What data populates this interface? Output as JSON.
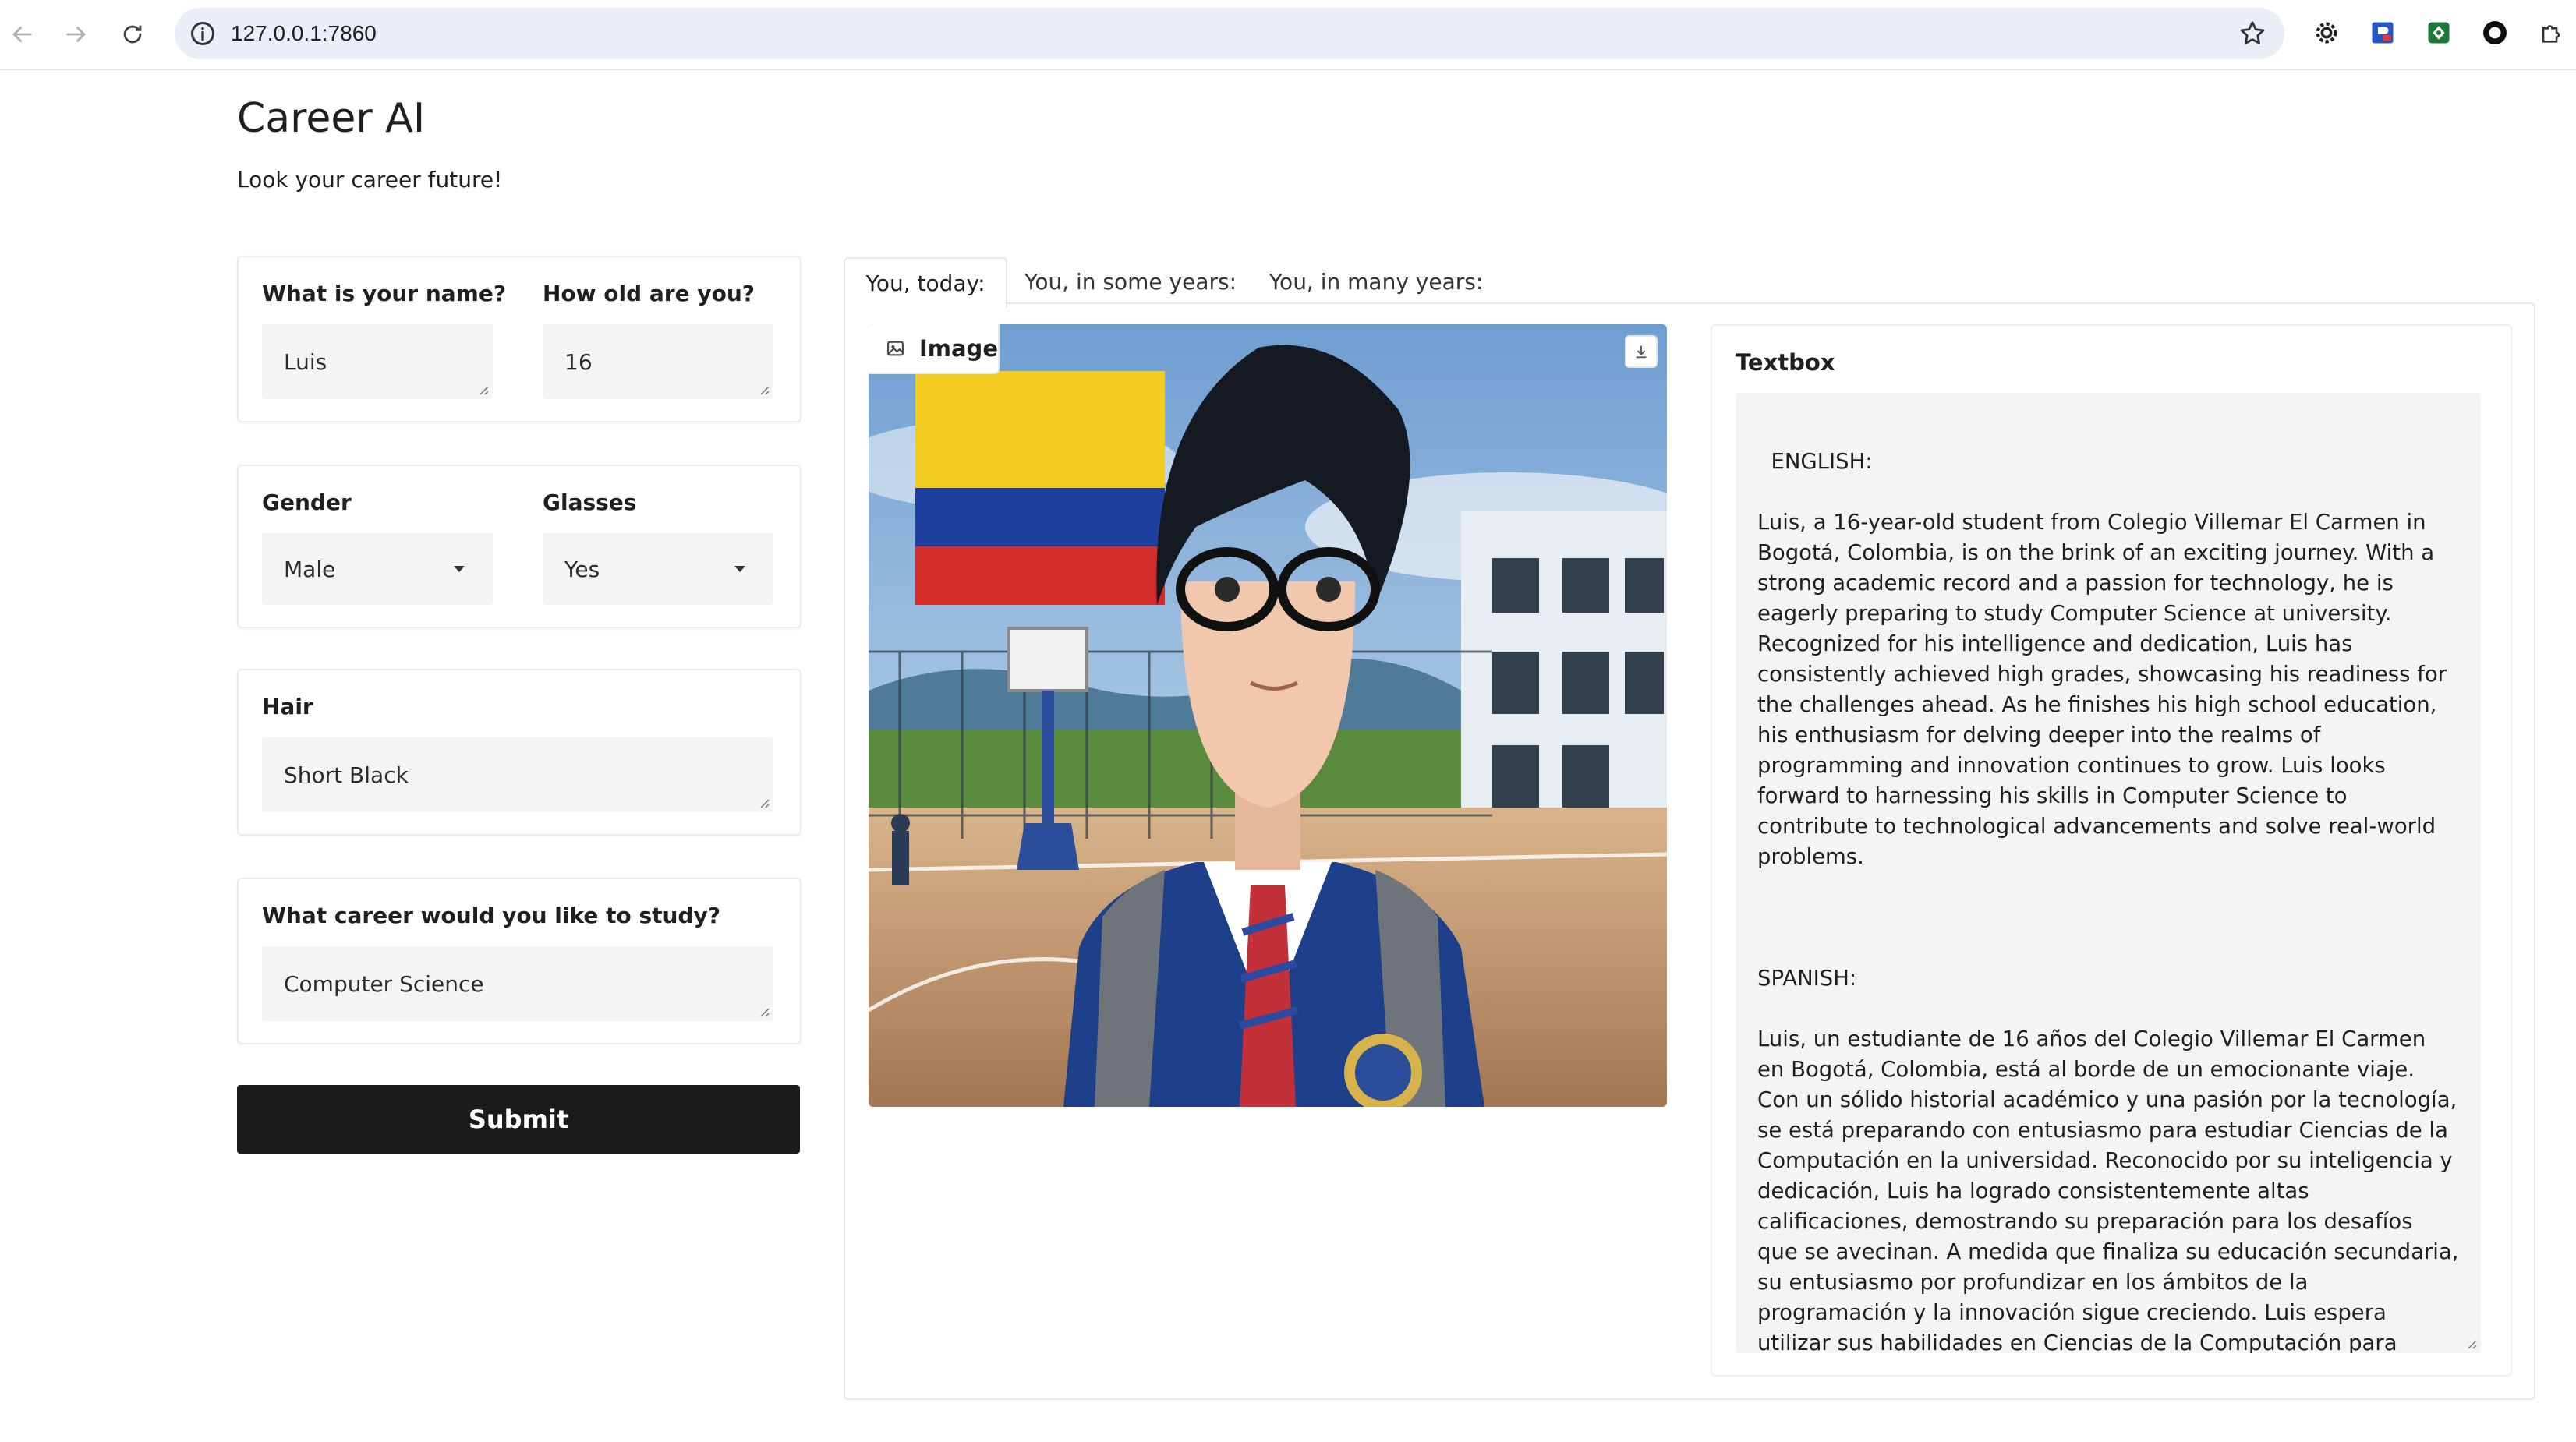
{
  "browser": {
    "url": "127.0.0.1:7860"
  },
  "app": {
    "title": "Career AI",
    "subtitle": "Look your career future!"
  },
  "form": {
    "name_label": "What is your name?",
    "name_value": "Luis",
    "age_label": "How old are you?",
    "age_value": "16",
    "gender_label": "Gender",
    "gender_value": "Male",
    "glasses_label": "Glasses",
    "glasses_value": "Yes",
    "hair_label": "Hair",
    "hair_value": "Short Black",
    "career_label": "What career would you like to study?",
    "career_value": "Computer Science",
    "submit_label": "Submit"
  },
  "tabs": [
    {
      "label": "You, today:",
      "active": true
    },
    {
      "label": "You, in some years:",
      "active": false
    },
    {
      "label": "You, in many years:",
      "active": false
    }
  ],
  "output": {
    "image_label": "Image",
    "textbox_label": "Textbox",
    "textbox_value": "ENGLISH:\n\nLuis, a 16-year-old student from Colegio Villemar El Carmen in Bogotá, Colombia, is on the brink of an exciting journey. With a strong academic record and a passion for technology, he is eagerly preparing to study Computer Science at university. Recognized for his intelligence and dedication, Luis has consistently achieved high grades, showcasing his readiness for the challenges ahead. As he finishes his high school education, his enthusiasm for delving deeper into the realms of programming and innovation continues to grow. Luis looks forward to harnessing his skills in Computer Science to contribute to technological advancements and solve real-world problems.\n\n\n\nSPANISH:\n\nLuis, un estudiante de 16 años del Colegio Villemar El Carmen en Bogotá, Colombia, está al borde de un emocionante viaje. Con un sólido historial académico y una pasión por la tecnología, se está preparando con entusiasmo para estudiar Ciencias de la Computación en la universidad. Reconocido por su inteligencia y dedicación, Luis ha logrado consistentemente altas calificaciones, demostrando su preparación para los desafíos que se avecinan. A medida que finaliza su educación secundaria, su entusiasmo por profundizar en los ámbitos de la programación y la innovación sigue creciendo. Luis espera utilizar sus habilidades en Ciencias de la Computación para contribuir a los avances tecnológicos y resolver problemas del mundo real."
  },
  "icons": {
    "back": "arrow-left-icon",
    "forward": "arrow-right-icon",
    "reload": "reload-icon",
    "site_info": "info-icon",
    "bookmark": "star-icon",
    "image_label_icon": "image-icon",
    "download": "download-icon"
  },
  "colors": {
    "submit_bg": "#1b1b1b",
    "input_bg": "#f4f4f5",
    "omnibox_bg": "#eaeef6"
  }
}
